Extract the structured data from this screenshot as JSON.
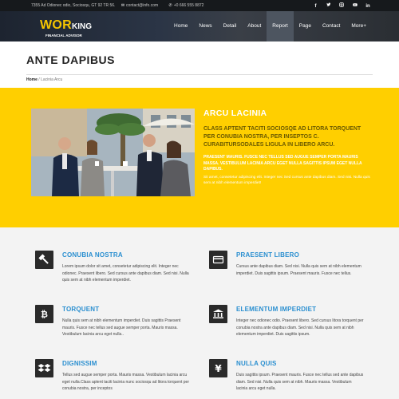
{
  "topbar": {
    "address": "7355 Ad Odionec odio, Sociosqu, GT 92 TR 56.",
    "email": "contact@info.com",
    "phone": "+0 666 555 8872",
    "social": [
      "facebook-icon",
      "twitter-icon",
      "instagram-icon",
      "youtube-icon",
      "linkedin-icon"
    ]
  },
  "logo": {
    "big": "WOR",
    "small": "KING",
    "tagline": "FINANCIAL ADVISOR"
  },
  "nav": [
    "Home",
    "News",
    "Detail",
    "About",
    "Report",
    "Page",
    "Contact",
    "More+"
  ],
  "nav_active": "Report",
  "page": {
    "title": "ANTE DAPIBUS",
    "breadcrumb_home": "Home",
    "breadcrumb_sep": " / ",
    "breadcrumb_current": "Lacinia Arcu"
  },
  "feature": {
    "heading": "ARCU LACINIA",
    "lead": "CLASS APTENT TACITI SOCIOSQE AD LITORA TORQUENT PER CONUBIA NOSTRA, PER INSEPTOS C. CURABITURSODALES LIGULA IN LIBERO ARCU.",
    "para1": "PRAESENT MAURIS. FUSCE NEC TELLUS SED AUGUE SEMPER PORTA MAURIS MASSA. VESTIBULUM LACINIA ARCU EGET NULLA SAGITTIS IPSUM EGET NULLA DAPIBUS.",
    "para2": "Sit amet, consetetur adipiscing elit. Integer nec Sed cursus ante dapibus diam. Sed nisi. Nulla quis sem at nibh elementum imperdiet!"
  },
  "services": [
    {
      "icon": "gavel-icon",
      "title": "CONUBIA NOSTRA",
      "text": "Lorem ipsum dolor sit amet, consetetur adipiscing elit. Integer nec odionec. Praesent libero. Sed cursus ante dapibus diam. Sed nisi. Nulla quis sem at nibh elementum imperdiet."
    },
    {
      "icon": "credit-card-icon",
      "title": "PRAESENT LIBERO",
      "text": "Cursus ante dapibus diam. Sed nisi. Nulla quis sem at nibh elementum imperdiet. Duis sagittis ipsum. Praesent mauris. Fusce nec tellus."
    },
    {
      "icon": "bitcoin-icon",
      "title": "TORQUENT",
      "text": "Nulla quis sem at nibh elementum imperdiet. Duis sagittis Praesent mauris. Fusce nec tellus sed augue semper porta. Mauris massa. Vestibulum lacinia arcu eget nulla.."
    },
    {
      "icon": "bank-icon",
      "title": "ELEMENTUM IMPERDIET",
      "text": "Integer nec odionec odio. Praesent libero. Sed cursus litora torquent per conubia nostra ante dapibus diam. Sed nisi. Nulla quis sem at nibh elementum imperdiet. Duis sagittis ipsum."
    },
    {
      "icon": "dropbox-icon",
      "title": "DIGNISSIM",
      "text": "Tellus sed augue semper porta. Mauris massa. Vestibulum lacinia arcu eget nulla.Class aptent taciti lacinia nunc sociosqu ad litora torquent per conubia nostra, per inceptos"
    },
    {
      "icon": "yen-icon",
      "title": "NULLA QUIS",
      "text": "Duis sagittis ipsum. Praesent mauris. Fusce nec tellus sed ante dapibus diam. Sed nisi. Nulla quis sem at nibh. Mauris massa. Vestibulum lacinia arcu eget nulla."
    }
  ]
}
